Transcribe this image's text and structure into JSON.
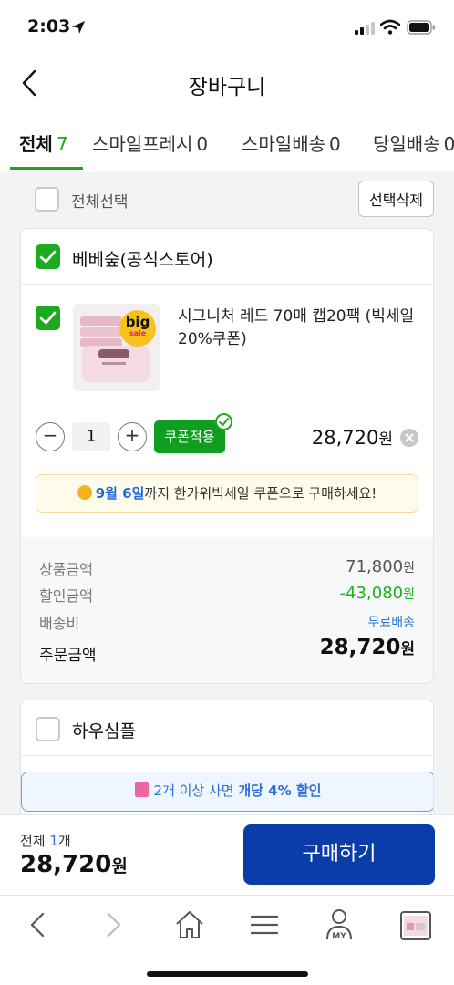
{
  "status_bar": {
    "time": "2:03"
  },
  "header": {
    "title": "장바구니"
  },
  "tabs": [
    {
      "label": "전체",
      "count": "7"
    },
    {
      "label": "스마일프레시",
      "count": "0"
    },
    {
      "label": "스마일배송",
      "count": "0"
    },
    {
      "label": "당일배송",
      "count": "0"
    }
  ],
  "select_all": {
    "label": "전체선택",
    "delete_label": "선택삭제"
  },
  "seller1": {
    "name": "베베숲(공식스토어)",
    "product": {
      "name": "시그니처 레드 70매 캡20팩 (빅세일20%쿠폰)",
      "thumb_badge_big": "big",
      "thumb_badge_sale": "sale",
      "quantity": "1",
      "coupon_label": "쿠폰적용",
      "price": "28,720",
      "price_unit": "원"
    },
    "promo": {
      "date": "9월 6일",
      "text": "까지 한가위빅세일 쿠폰으로 구매하세요!"
    },
    "summary": {
      "goods_label": "상품금액",
      "goods_value": "71,800",
      "discount_label": "할인금액",
      "discount_value": "-43,080",
      "shipping_label": "배송비",
      "shipping_value": "무료배송",
      "order_label": "주문금액",
      "order_value": "28,720",
      "unit": "원"
    }
  },
  "seller2": {
    "name": "하우심플",
    "bundle": {
      "text_normal": "2개 이상 사면 ",
      "text_strong": "개당 4% 할인"
    }
  },
  "bottom": {
    "count_prefix": "전체 ",
    "count": "1",
    "count_suffix": "개",
    "total": "28,720",
    "unit": "원",
    "buy_label": "구매하기"
  },
  "toolbar": {
    "my_label": "MY"
  },
  "colors": {
    "green": "#1eaa1e",
    "blue": "#0a3da8",
    "link_blue": "#2676d2"
  }
}
